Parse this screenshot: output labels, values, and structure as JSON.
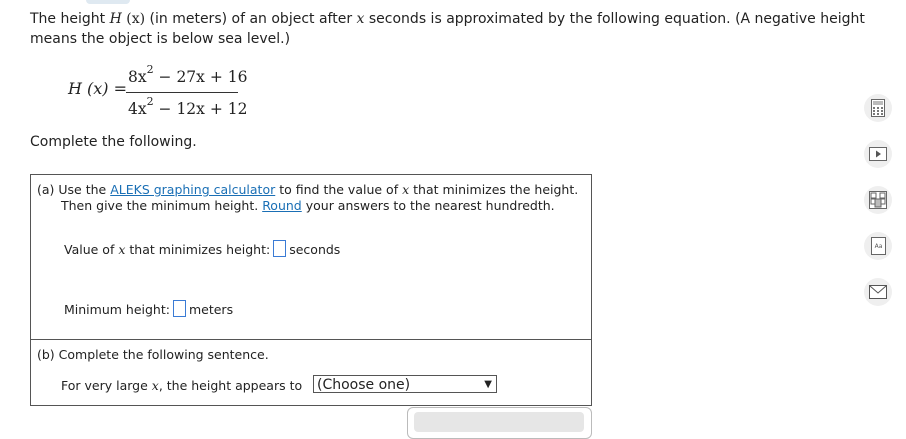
{
  "intro": {
    "text1": "The height ",
    "var_H": "H",
    "paren_x": " (x)",
    "text2": " (in meters) of an object after ",
    "var_x": "x",
    "text3": " seconds is approximated by the following equation. (A negative height means the object is below sea level.)"
  },
  "equation": {
    "lhs": "H (x) =",
    "num_a": "8x",
    "num_exp": "2",
    "num_b": " − 27x + 16",
    "den_a": "4x",
    "den_exp": "2",
    "den_b": " − 12x + 12"
  },
  "complete_label": "Complete the following.",
  "part_a": {
    "prefix": "(a)  Use the ",
    "calc_link": "ALEKS graphing calculator",
    "mid": " to find the value of ",
    "var_x": "x",
    "suffix": " that minimizes the height.",
    "line2_pre": "Then give the minimum height. ",
    "round_link": "Round",
    "line2_post": " your answers to the nearest hundredth.",
    "q1_pre": "Value of ",
    "q1_var": "x",
    "q1_post": " that minimizes height:",
    "q1_unit": "seconds",
    "q2_label": "Minimum height:",
    "q2_unit": "meters"
  },
  "part_b": {
    "title": "(b)  Complete the following sentence.",
    "sent_pre": "For very large ",
    "sent_var": "x",
    "sent_post": ", the height appears to",
    "select_value": "(Choose one)"
  },
  "tools": [
    "calculator-icon",
    "video-icon",
    "periodic-table-icon",
    "dictionary-icon",
    "mail-icon"
  ]
}
